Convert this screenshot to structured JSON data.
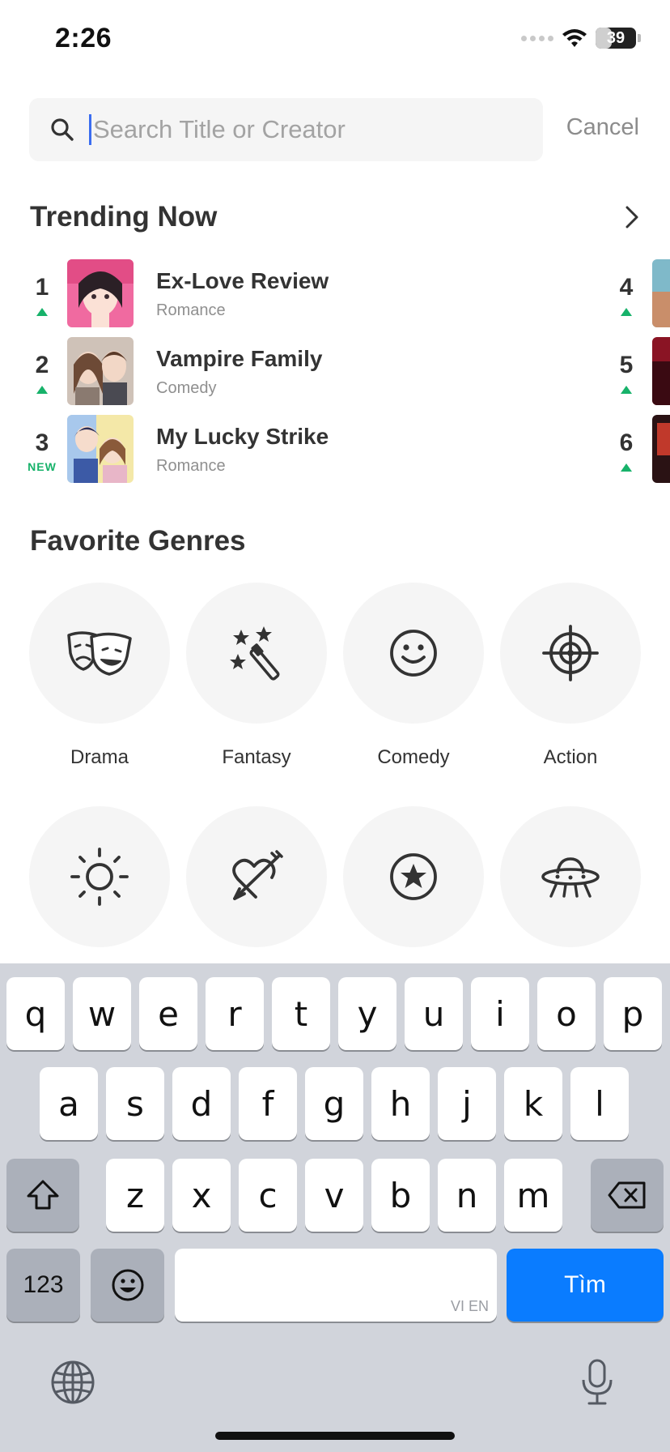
{
  "status": {
    "time": "2:26",
    "battery": "39",
    "battery_level": 0.39
  },
  "search": {
    "placeholder": "Search Title or Creator",
    "cancel_label": "Cancel"
  },
  "trending": {
    "title": "Trending Now",
    "items": [
      {
        "rank": "1",
        "badge": "",
        "trend": "up",
        "title": "Ex-Love Review",
        "genre": "Romance"
      },
      {
        "rank": "2",
        "badge": "",
        "trend": "up",
        "title": "Vampire Family",
        "genre": "Comedy"
      },
      {
        "rank": "3",
        "badge": "NEW",
        "trend": "new",
        "title": "My Lucky Strike",
        "genre": "Romance"
      }
    ],
    "right_column": [
      {
        "rank": "4",
        "trend": "up"
      },
      {
        "rank": "5",
        "trend": "up"
      },
      {
        "rank": "6",
        "trend": "up"
      }
    ]
  },
  "genres": {
    "title": "Favorite Genres",
    "items": [
      {
        "label": "Drama",
        "icon": "drama-masks-icon"
      },
      {
        "label": "Fantasy",
        "icon": "magic-wand-icon"
      },
      {
        "label": "Comedy",
        "icon": "smiley-icon"
      },
      {
        "label": "Action",
        "icon": "crosshair-icon"
      },
      {
        "label": "",
        "icon": "sun-icon"
      },
      {
        "label": "",
        "icon": "heart-arrow-icon"
      },
      {
        "label": "",
        "icon": "star-circle-icon"
      },
      {
        "label": "",
        "icon": "ufo-icon"
      }
    ]
  },
  "keyboard": {
    "row1": [
      "q",
      "w",
      "e",
      "r",
      "t",
      "y",
      "u",
      "i",
      "o",
      "p"
    ],
    "row2": [
      "a",
      "s",
      "d",
      "f",
      "g",
      "h",
      "j",
      "k",
      "l"
    ],
    "row3": [
      "z",
      "x",
      "c",
      "v",
      "b",
      "n",
      "m"
    ],
    "numbers_label": "123",
    "return_label": "Tìm",
    "space_lang": "VI EN"
  }
}
